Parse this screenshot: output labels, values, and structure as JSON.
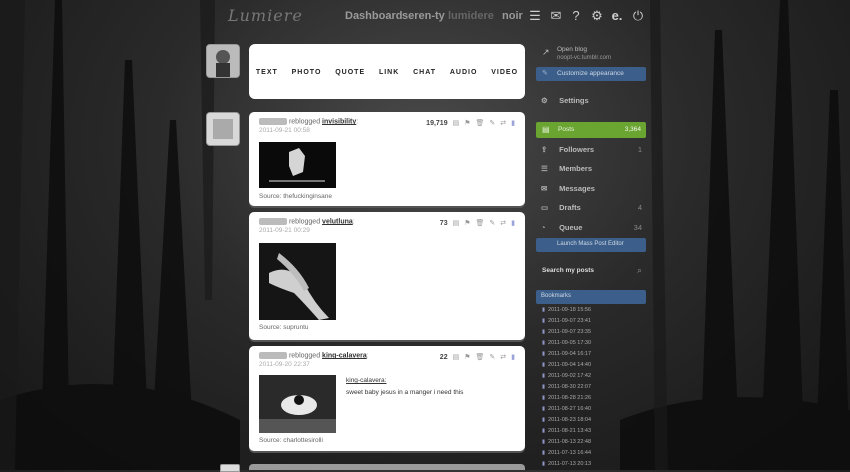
{
  "topbar": {
    "logo": "Lumiere",
    "links": [
      "Dashboard",
      "seren-ty",
      "lumidere",
      "noir"
    ],
    "icons": [
      "list-icon",
      "mail-icon",
      "help-icon",
      "gear-icon",
      "tumblr-icon",
      "power-icon"
    ]
  },
  "composer": {
    "types": [
      "TEXT",
      "PHOTO",
      "QUOTE",
      "LINK",
      "CHAT",
      "AUDIO",
      "VIDEO"
    ]
  },
  "posts": [
    {
      "reblogged": "reblogged",
      "blog": "invisibility",
      "date": "2011-09-21 00:58",
      "notes": "19,719",
      "source": "Source: thefuckinginsane"
    },
    {
      "reblogged": "reblogged",
      "blog": "velutluna",
      "date": "2011-09-21 00:29",
      "notes": "73",
      "source": "Source: supruntu"
    },
    {
      "reblogged": "reblogged",
      "blog": "king-calavera",
      "date": "2011-09-20 22:37",
      "notes": "22",
      "source": "Source: charlottesirolli",
      "caption_author": "king-calavera:",
      "caption_text": "sweet baby jesus in a manger i need this"
    }
  ],
  "sidebar": {
    "open_blog": "Open blog",
    "blog_url": "noopt-vc.tumblr.com",
    "customize": "Customize appearance",
    "settings": "Settings",
    "posts": {
      "label": "Posts",
      "count": "3,364"
    },
    "followers": {
      "label": "Followers",
      "count": "1"
    },
    "members": {
      "label": "Members",
      "count": ""
    },
    "messages": {
      "label": "Messages",
      "count": ""
    },
    "drafts": {
      "label": "Drafts",
      "count": "4"
    },
    "queue": {
      "label": "Queue",
      "count": "34"
    },
    "mass_editor": "Launch Mass Post Editor",
    "search_label": "Search my posts",
    "bookmarks_label": "Bookmarks",
    "bookmarks": [
      "2011-09-18 15:56",
      "2011-09-07 23:41",
      "2011-09-07 23:35",
      "2011-09-05 17:30",
      "2011-09-04 16:17",
      "2011-09-04 14:40",
      "2011-09-02 17:42",
      "2011-08-30 22:07",
      "2011-08-28 21:26",
      "2011-08-27 16:40",
      "2011-08-23 18:04",
      "2011-08-21 13:43",
      "2011-08-13 22:48",
      "2011-07-13 16:44",
      "2011-07-13 20:13"
    ]
  },
  "colors": {
    "accent_blue": "#3b5f8a",
    "posts_green": "#6aa532"
  }
}
